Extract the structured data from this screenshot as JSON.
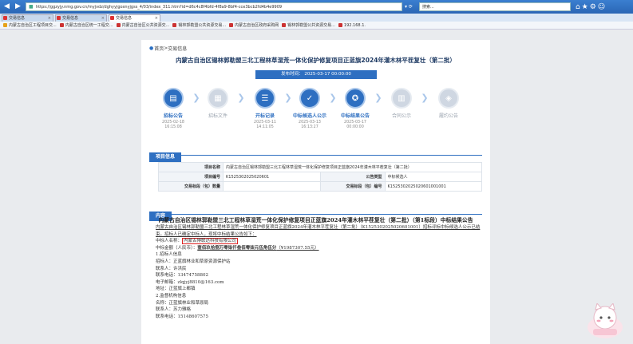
{
  "browser": {
    "url": "https://ggzyjy.nmg.gov.cn/myjvdz/dghyyjgoxnyjgss_4/03/index_311.htm?id=d6c4c8f4bfd-4f8a9-8bf4-cce3bcb2fd4b4e9909",
    "search_placeholder": "搜索...",
    "tabs": [
      {
        "label": "交易信息",
        "active": false
      },
      {
        "label": "交易信息",
        "active": false
      },
      {
        "label": "交易信息",
        "active": true
      }
    ],
    "bookmarks": [
      "内蒙古自治区工程项目交...",
      "内蒙古自治区统一工程交...",
      "内蒙古自治区公共资源交...",
      "锡林郭勒盟公共资源交易...",
      "内蒙古自治区政府采购网",
      "锡林郭勒盟公共资源交易...",
      "192.168.1."
    ]
  },
  "breadcrumb": {
    "home": "首页",
    "separator": ">",
    "current": "交易信息"
  },
  "page_title": "内蒙古自治区锡林郭勒盟三北工程林草湿荒一体化保护修复项目正蓝旗2024年灌木林平茬复壮（第二批）",
  "publish_time": "发布时间： 2025-03-17 00:00:00",
  "steps": [
    {
      "label": "招标公告",
      "date": "2025-02-18",
      "time": "16:15:08",
      "active": true,
      "icon": "clipboard-icon"
    },
    {
      "label": "招标文件",
      "date": "",
      "time": "",
      "active": false,
      "icon": "document-icon"
    },
    {
      "label": "开标记录",
      "date": "2025-03-11",
      "time": "14:11:05",
      "active": true,
      "icon": "list-icon"
    },
    {
      "label": "中标候选人公示",
      "date": "2025-03-13",
      "time": "16:13:27",
      "active": true,
      "icon": "check-icon"
    },
    {
      "label": "中标结果公告",
      "date": "2025-03-17",
      "time": "00:00:00",
      "active": true,
      "icon": "medal-icon"
    },
    {
      "label": "合同公示",
      "date": "",
      "time": "",
      "active": false,
      "icon": "contract-icon"
    },
    {
      "label": "履约公告",
      "date": "",
      "time": "",
      "active": false,
      "icon": "handshake-icon"
    }
  ],
  "project_info": {
    "heading": "项目信息",
    "rows": [
      {
        "k1": "项目名称",
        "v1": "内蒙古自治区锡林郭勒盟三北工程林草湿荒一体化保护修复项目正蓝旗2024年灌木林平茬复壮（第二批）"
      },
      {
        "k1": "项目编号",
        "v1": "K1525302025020601",
        "k2": "公告类型",
        "v2": "中标候选人"
      },
      {
        "k1": "交易标段（包）数量",
        "v1": "",
        "k2": "交易标段（包）编号",
        "v2": "K1525302025020601001001"
      }
    ]
  },
  "content": {
    "heading": "内容",
    "doc_title": "内蒙古自治区锡林郭勒盟三北工程林草湿荒一体化保护修复项目正蓝旗2024年灌木林平茬复壮（第二批）（第1标段）中标结果公告",
    "intro": "内蒙古自治区锡林郭勒盟三北工程林草湿荒一体化保护修复项目正蓝旗2024年灌木林平茬复壮（第二批）（K1525302025020601001）招标评标中标候选人公示已结束。招标人已确定中标人，现将中标结果公告如下：",
    "winner_label": "中标人名称：",
    "winner_name": "内蒙古博联达科技有限公司",
    "amount_label": "中标金额（人民币）：",
    "amount_words": "壹佰玖拾捌万零柒仟叁佰零柒元伍角伍分",
    "amount_value": "（¥1987307.55元）",
    "lines": [
      "1.招标人信息",
      "招标人：正蓝旗林业和草原资源保护站",
      "联系人：许洪民",
      "联系电话：13474758802",
      "电子邮箱：zlqjyj8810@163.com",
      "地址：正蓝旗上都镇",
      "2.监督机构信息",
      "名称：正蓝旗林业和草原局",
      "联系人：苏力雅格",
      "联系电话：15148607575"
    ]
  }
}
